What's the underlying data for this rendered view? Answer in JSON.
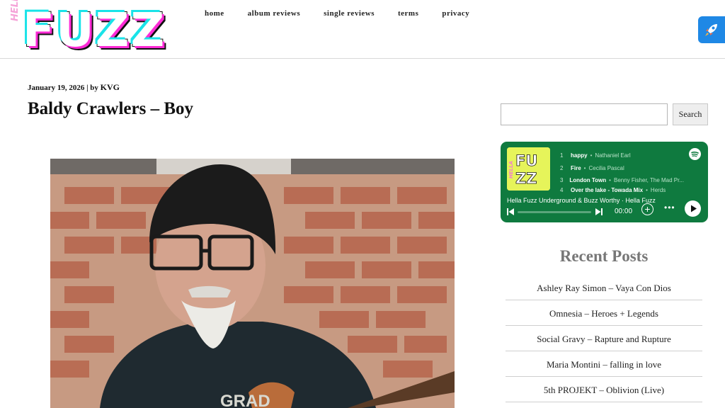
{
  "logo": {
    "small_text": "HELLA",
    "big_text": "FUZZ"
  },
  "nav": [
    "home",
    "album reviews",
    "single reviews",
    "terms",
    "privacy"
  ],
  "post": {
    "date": "January 19, 2026",
    "separator": " | by ",
    "author": "KVG",
    "title": "Baldy Crawlers – Boy"
  },
  "search": {
    "button_label": "Search",
    "value": ""
  },
  "spotify": {
    "cover_small": "HELLA",
    "cover_big": "FUZZ",
    "tracks": [
      {
        "num": "1",
        "name": "happy",
        "artist": "Nathaniel Earl"
      },
      {
        "num": "2",
        "name": "Fire",
        "artist": "Cecilia Pascal"
      },
      {
        "num": "3",
        "name": "London Town",
        "artist": "Benny Fisher, The Mad Pr..."
      },
      {
        "num": "4",
        "name": "Over the lake - Towada Mix",
        "artist": "Herds"
      }
    ],
    "playlist": "Hella Fuzz Underground & Buzz Worthy · Hella Fuzz",
    "time": "00:00",
    "progress": 0
  },
  "recent": {
    "title": "Recent Posts",
    "items": [
      "Ashley Ray Simon – Vaya Con Dios",
      "Omnesia – Heroes + Legends",
      "Social Gravy – Rapture and Rupture",
      "Maria Montini – falling in love",
      "5th PROJEKT – Oblivion (Live)"
    ]
  },
  "colors": {
    "spotify_green": "#0f7a3f",
    "rocket_blue": "#1f88e5",
    "recent_title": "#777777"
  }
}
